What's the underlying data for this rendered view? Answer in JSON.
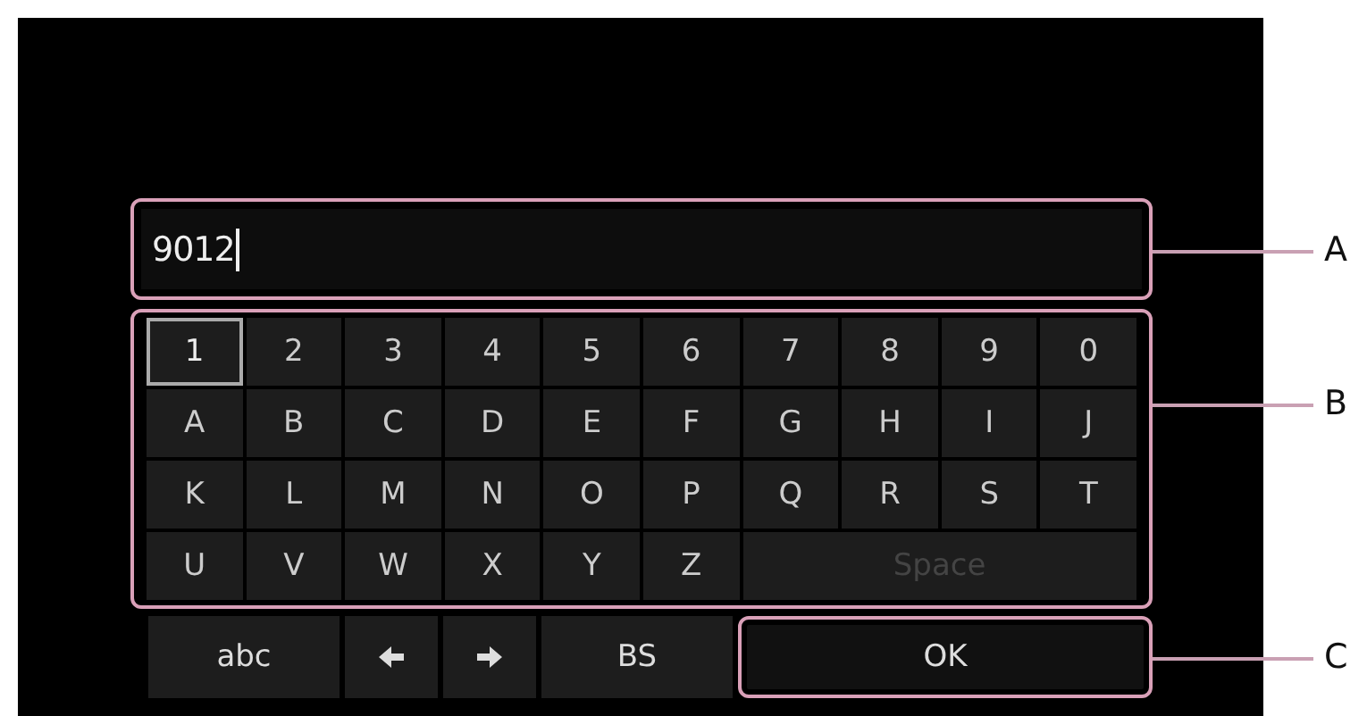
{
  "input": {
    "value": "9012"
  },
  "key_rows": [
    [
      {
        "label": "1",
        "selected": true,
        "disabled": false
      },
      {
        "label": "2",
        "selected": false,
        "disabled": false
      },
      {
        "label": "3",
        "selected": false,
        "disabled": false
      },
      {
        "label": "4",
        "selected": false,
        "disabled": false
      },
      {
        "label": "5",
        "selected": false,
        "disabled": false
      },
      {
        "label": "6",
        "selected": false,
        "disabled": false
      },
      {
        "label": "7",
        "selected": false,
        "disabled": false
      },
      {
        "label": "8",
        "selected": false,
        "disabled": false
      },
      {
        "label": "9",
        "selected": false,
        "disabled": false
      },
      {
        "label": "0",
        "selected": false,
        "disabled": false
      }
    ],
    [
      {
        "label": "A",
        "selected": false,
        "disabled": false
      },
      {
        "label": "B",
        "selected": false,
        "disabled": false
      },
      {
        "label": "C",
        "selected": false,
        "disabled": false
      },
      {
        "label": "D",
        "selected": false,
        "disabled": false
      },
      {
        "label": "E",
        "selected": false,
        "disabled": false
      },
      {
        "label": "F",
        "selected": false,
        "disabled": false
      },
      {
        "label": "G",
        "selected": false,
        "disabled": false
      },
      {
        "label": "H",
        "selected": false,
        "disabled": false
      },
      {
        "label": "I",
        "selected": false,
        "disabled": false
      },
      {
        "label": "J",
        "selected": false,
        "disabled": false
      }
    ],
    [
      {
        "label": "K",
        "selected": false,
        "disabled": false
      },
      {
        "label": "L",
        "selected": false,
        "disabled": false
      },
      {
        "label": "M",
        "selected": false,
        "disabled": false
      },
      {
        "label": "N",
        "selected": false,
        "disabled": false
      },
      {
        "label": "O",
        "selected": false,
        "disabled": false
      },
      {
        "label": "P",
        "selected": false,
        "disabled": false
      },
      {
        "label": "Q",
        "selected": false,
        "disabled": false
      },
      {
        "label": "R",
        "selected": false,
        "disabled": false
      },
      {
        "label": "S",
        "selected": false,
        "disabled": false
      },
      {
        "label": "T",
        "selected": false,
        "disabled": false
      }
    ],
    [
      {
        "label": "U",
        "selected": false,
        "disabled": false
      },
      {
        "label": "V",
        "selected": false,
        "disabled": false
      },
      {
        "label": "W",
        "selected": false,
        "disabled": false
      },
      {
        "label": "X",
        "selected": false,
        "disabled": false
      },
      {
        "label": "Y",
        "selected": false,
        "disabled": false
      },
      {
        "label": "Z",
        "selected": false,
        "disabled": false
      },
      {
        "label": "Space",
        "selected": false,
        "disabled": true
      }
    ]
  ],
  "bottom_keys": [
    {
      "kind": "text",
      "label": "abc"
    },
    {
      "kind": "left-arrow"
    },
    {
      "kind": "right-arrow"
    },
    {
      "kind": "text",
      "label": "BS"
    },
    {
      "kind": "ok",
      "label": "OK"
    }
  ],
  "callouts": [
    {
      "label": "A"
    },
    {
      "label": "B"
    },
    {
      "label": "C"
    }
  ]
}
